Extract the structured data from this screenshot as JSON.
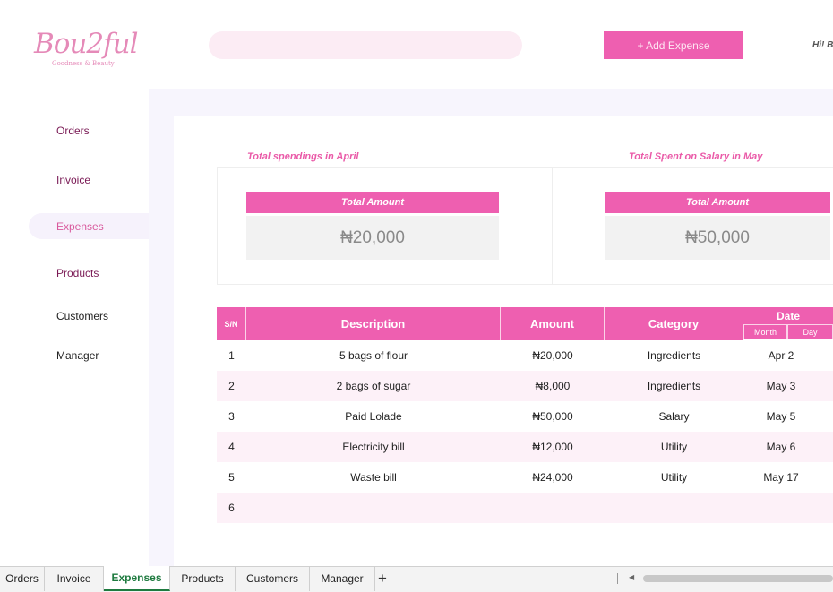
{
  "header": {
    "logo_main": "Bou2ful",
    "logo_sub": "Goodness & Beauty",
    "search_placeholder": "",
    "add_expense_label": "+ Add Expense",
    "greeting": "Hi! Bl"
  },
  "sidebar": {
    "items": [
      {
        "label": "Orders"
      },
      {
        "label": "Invoice"
      },
      {
        "label": "Expenses"
      },
      {
        "label": "Products"
      },
      {
        "label": "Customers"
      },
      {
        "label": "Manager"
      }
    ],
    "active": "Expenses"
  },
  "summary": {
    "left": {
      "title": "Total spendings in April",
      "head": "Total Amount",
      "value": "₦20,000"
    },
    "right": {
      "title": "Total Spent on Salary in  May",
      "head": "Total Amount",
      "value": "₦50,000"
    }
  },
  "table": {
    "headers": {
      "sn": "S/N",
      "description": "Description",
      "amount": "Amount",
      "category": "Category",
      "date": "Date",
      "month": "Month",
      "day": "Day"
    },
    "rows": [
      {
        "sn": "1",
        "description": "5  bags of flour",
        "amount": "₦20,000",
        "category": "Ingredients",
        "date": "Apr 2"
      },
      {
        "sn": "2",
        "description": "2 bags of sugar",
        "amount": "₦8,000",
        "category": "Ingredients",
        "date": "May 3"
      },
      {
        "sn": "3",
        "description": "Paid Lolade",
        "amount": "₦50,000",
        "category": "Salary",
        "date": "May 5"
      },
      {
        "sn": "4",
        "description": "Electricity bill",
        "amount": "₦12,000",
        "category": "Utility",
        "date": "May 6"
      },
      {
        "sn": "5",
        "description": "Waste bill",
        "amount": "₦24,000",
        "category": "Utility",
        "date": "May 17"
      },
      {
        "sn": "6",
        "description": "",
        "amount": "",
        "category": "",
        "date": ""
      }
    ]
  },
  "sheets": {
    "tabs": [
      {
        "label": "Orders"
      },
      {
        "label": "Invoice"
      },
      {
        "label": "Expenses"
      },
      {
        "label": "Products"
      },
      {
        "label": "Customers"
      },
      {
        "label": "Manager"
      }
    ],
    "active": "Expenses",
    "add_label": "+"
  },
  "colors": {
    "accent": "#ee5fb0",
    "logo": "#e58ab8",
    "active_sheet": "#1e7a3f"
  }
}
